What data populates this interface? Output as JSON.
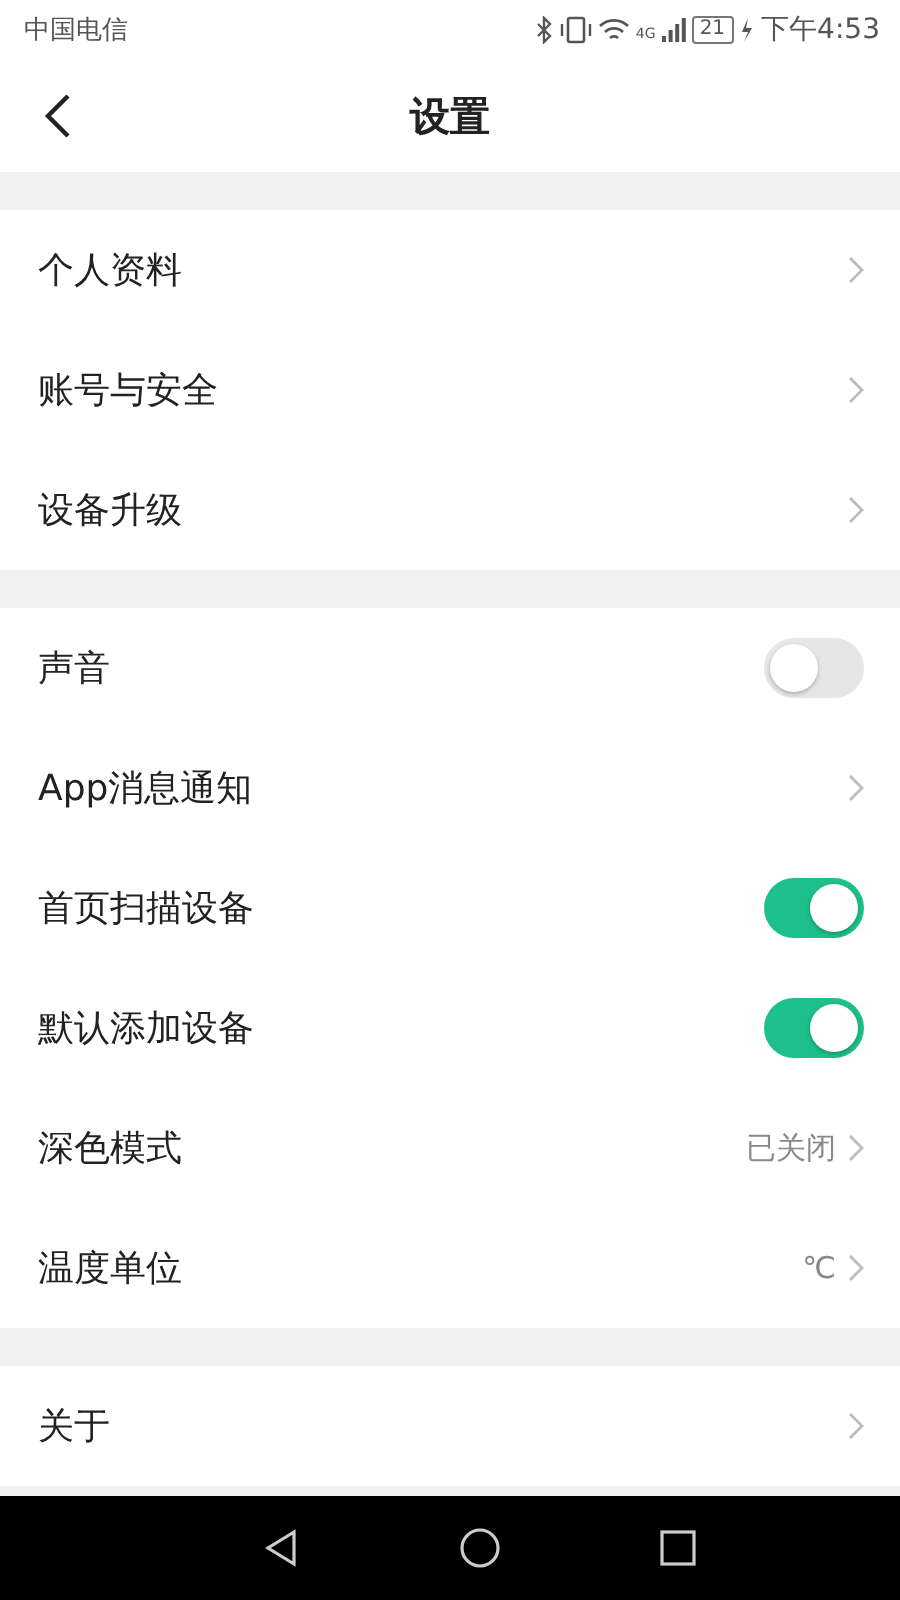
{
  "status_bar": {
    "carrier": "中国电信",
    "network": "4G",
    "battery": "21",
    "time": "下午4:53"
  },
  "header": {
    "title": "设置"
  },
  "groups": [
    {
      "items": [
        {
          "kind": "link",
          "label": "个人资料"
        },
        {
          "kind": "link",
          "label": "账号与安全"
        },
        {
          "kind": "link",
          "label": "设备升级"
        }
      ]
    },
    {
      "items": [
        {
          "kind": "toggle",
          "label": "声音",
          "on": false
        },
        {
          "kind": "link",
          "label": "App消息通知"
        },
        {
          "kind": "toggle",
          "label": "首页扫描设备",
          "on": true
        },
        {
          "kind": "toggle",
          "label": "默认添加设备",
          "on": true
        },
        {
          "kind": "link",
          "label": "深色模式",
          "value": "已关闭"
        },
        {
          "kind": "link",
          "label": "温度单位",
          "value": "℃"
        }
      ]
    },
    {
      "items": [
        {
          "kind": "link",
          "label": "关于"
        }
      ]
    }
  ]
}
